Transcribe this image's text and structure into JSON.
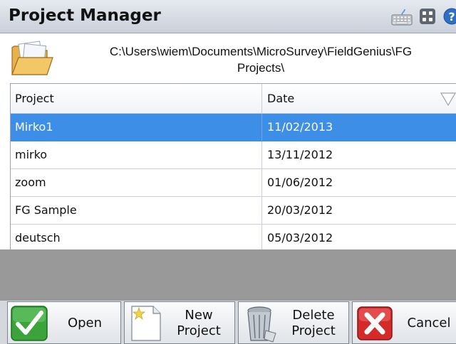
{
  "window": {
    "title": "Project Manager"
  },
  "toolbar_icons": [
    "keyboard-icon",
    "grid-icon",
    "help-icon"
  ],
  "path": {
    "line1": "C:\\Users\\wiem\\Documents\\MicroSurvey\\FieldGenius\\FG",
    "line2": "Projects\\"
  },
  "table": {
    "columns": {
      "project": "Project",
      "date": "Date"
    },
    "rows": [
      {
        "project": "Mirko1",
        "date": "11/02/2013",
        "selected": true
      },
      {
        "project": "mirko",
        "date": "13/11/2012"
      },
      {
        "project": "zoom",
        "date": "01/06/2012"
      },
      {
        "project": "FG Sample",
        "date": "20/03/2012"
      },
      {
        "project": "deutsch",
        "date": "05/03/2012"
      }
    ]
  },
  "buttons": {
    "open": "Open",
    "new_line1": "New",
    "new_line2": "Project",
    "delete_line1": "Delete",
    "delete_line2": "Project",
    "cancel": "Cancel"
  },
  "colors": {
    "selection": "#3d8ee6",
    "empty_area": "#999999",
    "ok_green": "#3aa43a",
    "cancel_red": "#d42a2a"
  }
}
